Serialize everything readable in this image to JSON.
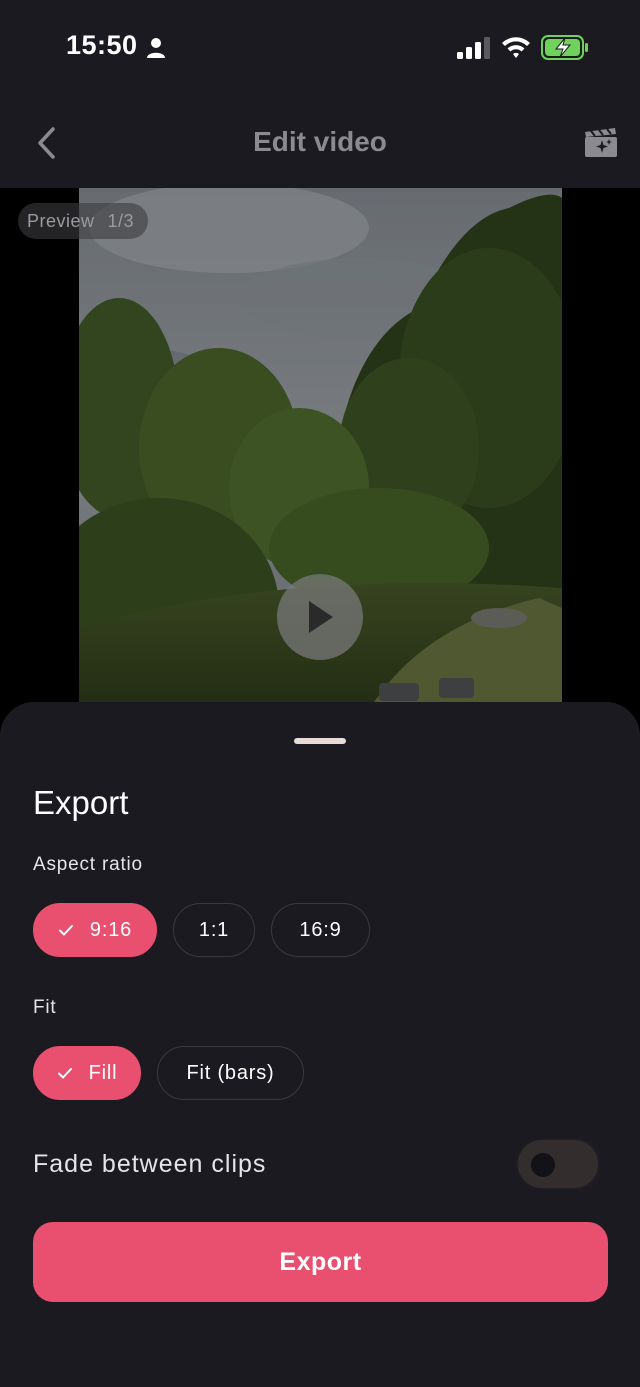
{
  "status_bar": {
    "time": "15:50",
    "icons": [
      "person-icon",
      "signal-icon",
      "wifi-icon",
      "battery-charging-icon"
    ]
  },
  "header": {
    "title": "Edit video",
    "back_icon": "chevron-left-icon",
    "action_icon": "clapperboard-sparkle-icon"
  },
  "preview": {
    "label": "Preview",
    "counter": "1/3",
    "play_icon": "play-icon"
  },
  "export_sheet": {
    "title": "Export",
    "aspect_ratio": {
      "label": "Aspect ratio",
      "options": [
        {
          "label": "9:16",
          "selected": true
        },
        {
          "label": "1:1",
          "selected": false
        },
        {
          "label": "16:9",
          "selected": false
        }
      ]
    },
    "fit": {
      "label": "Fit",
      "options": [
        {
          "label": "Fill",
          "selected": true
        },
        {
          "label": "Fit (bars)",
          "selected": false
        }
      ]
    },
    "fade": {
      "label": "Fade between clips",
      "enabled": false
    },
    "export_button": "Export"
  },
  "colors": {
    "accent": "#e9506f",
    "background": "#1b1a21",
    "title_muted": "#8b8a90"
  }
}
